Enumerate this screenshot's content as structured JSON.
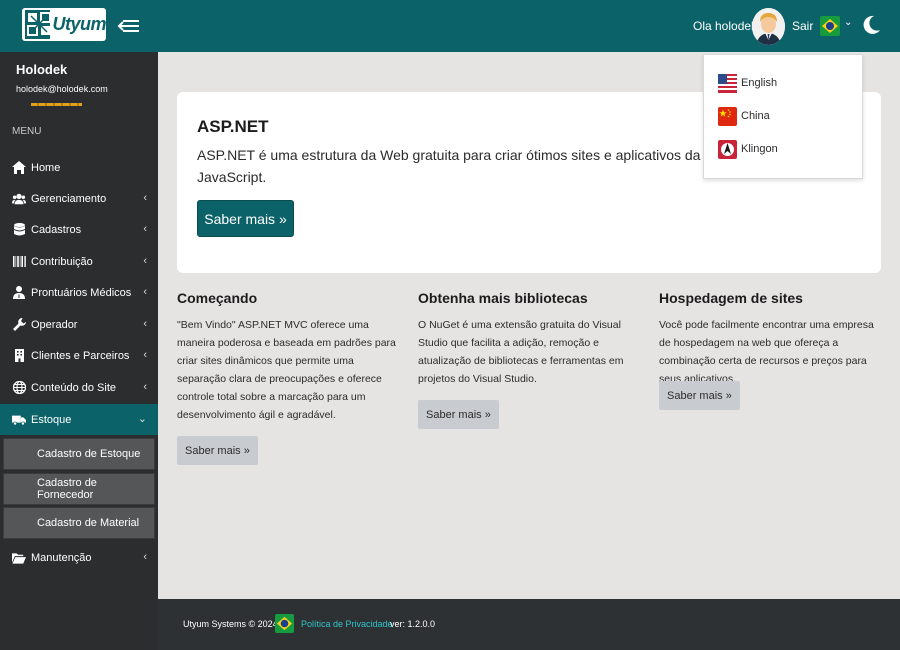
{
  "header": {
    "logo_text": "Utyum",
    "greeting": "Ola holodek",
    "logout_label": "Sair"
  },
  "user": {
    "name": "Holodek",
    "email": "holodek@holodek.com"
  },
  "sidebar": {
    "menu_header": "MENU",
    "items": [
      {
        "label": "Home",
        "icon": "home-icon"
      },
      {
        "label": "Gerenciamento",
        "icon": "users-icon"
      },
      {
        "label": "Cadastros",
        "icon": "database-icon"
      },
      {
        "label": "Contribuição",
        "icon": "barcode-icon"
      },
      {
        "label": "Prontuários Médicos",
        "icon": "user-md-icon"
      },
      {
        "label": "Operador",
        "icon": "wrench-icon"
      },
      {
        "label": "Clientes e Parceiros",
        "icon": "building-icon"
      },
      {
        "label": "Conteúdo do Site",
        "icon": "globe-icon"
      },
      {
        "label": "Estoque",
        "icon": "truck-icon"
      },
      {
        "label": "Manutenção",
        "icon": "folder-open-icon"
      }
    ],
    "subitems": [
      {
        "label": "Cadastro de Estoque"
      },
      {
        "label": "Cadastro de Fornecedor"
      },
      {
        "label": "Cadastro de Material"
      }
    ],
    "active_item": "Estoque"
  },
  "jumbotron": {
    "title": "ASP.NET",
    "lead_line1": "ASP.NET é uma estrutura da Web gratuita para criar ótimos sites e aplicativos da Web usa",
    "lead_line2": "JavaScript.",
    "button": "Saber mais »"
  },
  "columns": [
    {
      "title": "Começando",
      "text": "\"Bem Vindo\" ASP.NET MVC oferece uma maneira poderosa e baseada em padrões para criar sites dinâmicos que permite uma separação clara de preocupações e oferece controle total sobre a marcação para um desenvolvimento ágil e agradável.",
      "button": "Saber mais »"
    },
    {
      "title": "Obtenha mais bibliotecas",
      "text": "O NuGet é uma extensão gratuita do Visual Studio que facilita a adição, remoção e atualização de bibliotecas e ferramentas em projetos do Visual Studio.",
      "button": "Saber mais »"
    },
    {
      "title": "Hospedagem de sites",
      "text": "Você pode facilmente encontrar uma empresa de hospedagem na web que ofereça a combinação certa de recursos e preços para seus aplicativos.",
      "button": "Saber mais »"
    }
  ],
  "language_menu": [
    {
      "label": "English",
      "icon": "us-flag-icon"
    },
    {
      "label": "China",
      "icon": "china-flag-icon"
    },
    {
      "label": "Klingon",
      "icon": "klingon-flag-icon"
    }
  ],
  "footer": {
    "copyright": "Utyum Systems © 2024",
    "privacy_link": "Política de Privacidade",
    "version": "ver: 1.2.0.0"
  },
  "colors": {
    "brand": "#0b6369",
    "sidebar": "#2c2d2e",
    "background": "#e6e3e3",
    "footer": "#2e3134",
    "link": "#2ec6c8"
  }
}
